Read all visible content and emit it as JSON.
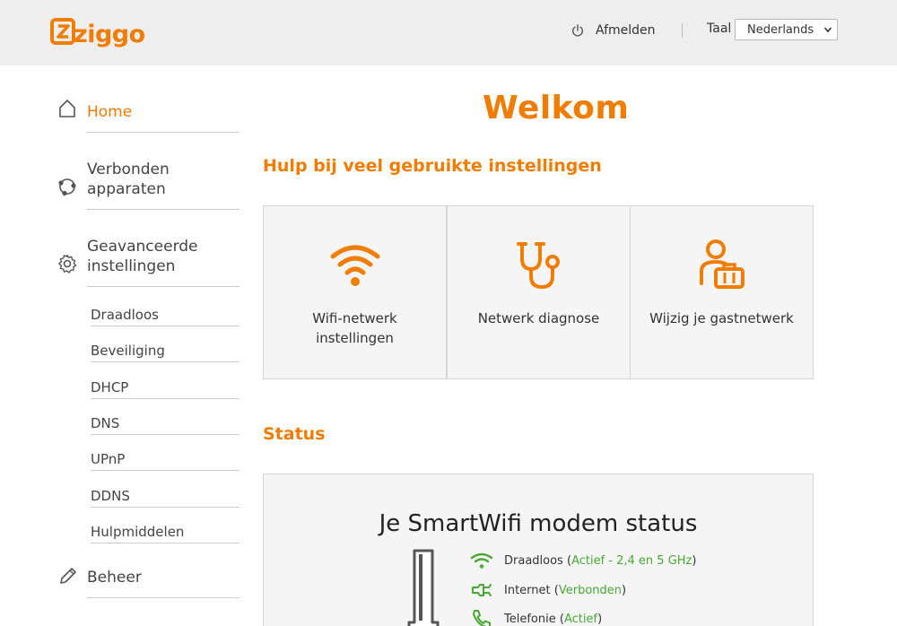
{
  "header": {
    "brand": "ziggo",
    "logout_label": "Afmelden",
    "language_label": "Taal",
    "language_value": "Nederlands"
  },
  "sidebar": {
    "main_items": [
      {
        "label": "Home",
        "icon": "home-icon",
        "active": true
      },
      {
        "label_line1": "Verbonden",
        "label_line2": "apparaten",
        "icon": "devices-icon"
      },
      {
        "label_line1": "Geavanceerde",
        "label_line2": "instellingen",
        "icon": "gear-icon"
      }
    ],
    "sub_items": [
      "Draadloos",
      "Beveiliging",
      "DHCP",
      "DNS",
      "UPnP",
      "DDNS",
      "Hulpmiddelen"
    ],
    "manage": {
      "label": "Beheer",
      "icon": "pencil-icon"
    }
  },
  "main": {
    "title": "Welkom",
    "help_title": "Hulp bij veel gebruikte instellingen",
    "tiles": [
      {
        "line1": "Wifi-netwerk",
        "line2": "instellingen",
        "icon": "wifi-icon"
      },
      {
        "line1": "Netwerk diagnose",
        "line2": "",
        "icon": "stethoscope-icon"
      },
      {
        "line1": "Wijzig je gastnetwerk",
        "line2": "",
        "icon": "guest-icon"
      }
    ],
    "status_title": "Status",
    "status_box": {
      "heading": "Je SmartWifi modem status",
      "rows": [
        {
          "label": "Draadloos",
          "state": "Actief - 2,4 en 5 GHz"
        },
        {
          "label": "Internet",
          "state": "Verbonden"
        },
        {
          "label": "Telefonie",
          "state": "Actief"
        }
      ]
    }
  },
  "colors": {
    "accent": "#f07c00",
    "status_ok": "#47a832",
    "header_bg": "#eeeeee"
  }
}
